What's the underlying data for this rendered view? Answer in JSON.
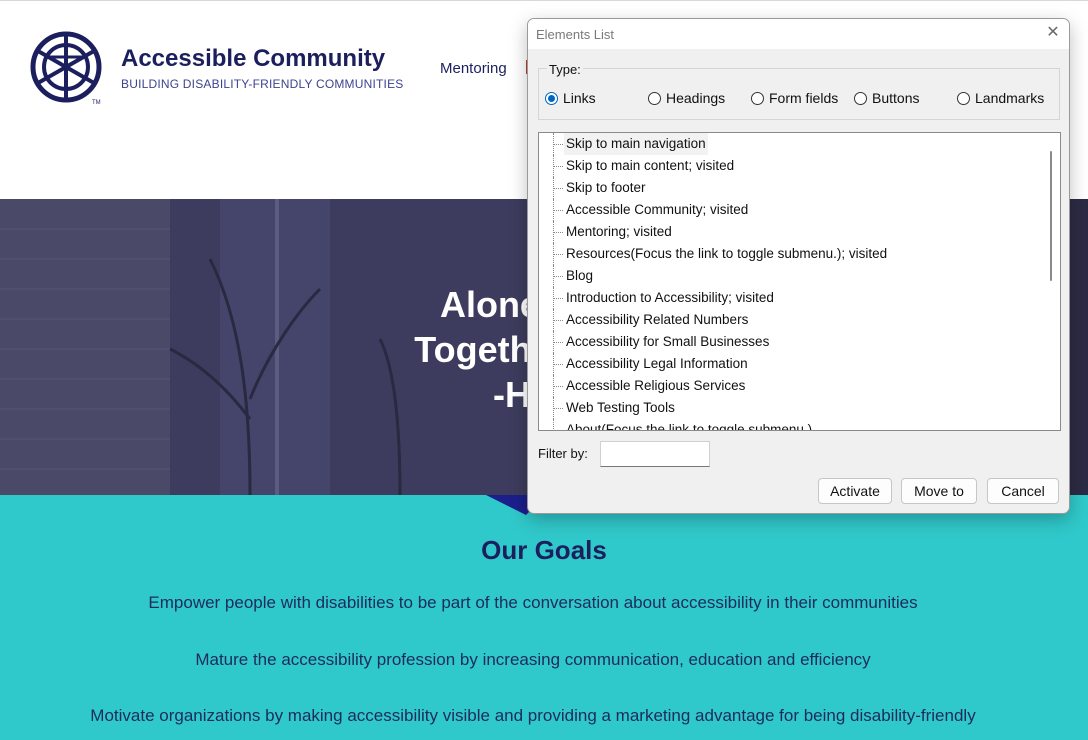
{
  "site": {
    "brand_name": "Accessible Community",
    "tagline": "BUILDING DISABILITY-FRIENDLY COMMUNITIES",
    "nav": [
      "Mentoring"
    ]
  },
  "hero": {
    "lines": [
      "Alone we ca",
      "Together we ca",
      "-Heler"
    ]
  },
  "goals": {
    "title": "Our Goals",
    "items": [
      "Empower people with disabilities to be part of the conversation about accessibility in their communities",
      "Mature the accessibility profession by increasing communication, education and efficiency",
      "Motivate organizations by making accessibility visible and providing a marketing advantage for being disability-friendly"
    ]
  },
  "dialog": {
    "title": "Elements List",
    "type_label": "Type:",
    "types": [
      {
        "label": "Links",
        "selected": true
      },
      {
        "label": "Headings",
        "selected": false
      },
      {
        "label": "Form fields",
        "selected": false
      },
      {
        "label": "Buttons",
        "selected": false
      },
      {
        "label": "Landmarks",
        "selected": false
      }
    ],
    "items": [
      "Skip to main navigation",
      "Skip to main content; visited",
      "Skip to footer",
      "Accessible Community; visited",
      "Mentoring; visited",
      "Resources(Focus the link to toggle submenu.); visited",
      "Blog",
      "Introduction to Accessibility; visited",
      "Accessibility Related Numbers",
      "Accessibility for Small Businesses",
      "Accessibility Legal Information",
      "Accessible Religious Services",
      "Web Testing Tools",
      "About(Focus the link to toggle submenu.)"
    ],
    "filter_label": "Filter by:",
    "filter_value": "",
    "buttons": {
      "activate": "Activate",
      "move_to": "Move to",
      "cancel": "Cancel"
    }
  },
  "colors": {
    "navy": "#1c1f5e",
    "teal": "#30c9cb",
    "hero_overlay": "#3b3a5c",
    "radio_accent": "#0067c0"
  }
}
